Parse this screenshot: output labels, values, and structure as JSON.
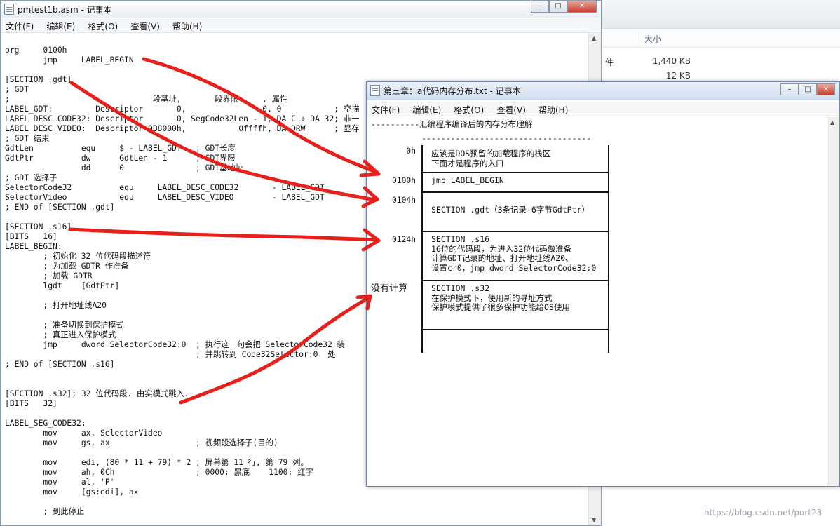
{
  "explorer": {
    "col_size": "大小",
    "rows": [
      {
        "frag": "件",
        "size": "1,440 KB"
      },
      {
        "frag": "",
        "size": "12 KB"
      }
    ]
  },
  "np1": {
    "title": "pmtest1b.asm - 记事本",
    "menu": [
      "文件(F)",
      "编辑(E)",
      "格式(O)",
      "查看(V)",
      "帮助(H)"
    ],
    "lines": [
      "org     0100h",
      "        jmp     LABEL_BEGIN",
      "",
      "[SECTION .gdt]",
      "; GDT",
      ";                              段基址,       段界限     , 属性",
      "LABEL_GDT:         Descriptor       0,                0, 0           ; 空描",
      "LABEL_DESC_CODE32: Descriptor       0, SegCode32Len - 1, DA_C + DA_32; 非一",
      "LABEL_DESC_VIDEO:  Descriptor 0B8000h,           0ffffh, DA_DRW      ; 显存",
      "; GDT 结束",
      "GdtLen          equ     $ - LABEL_GDT   ; GDT长度",
      "GdtPtr          dw      GdtLen - 1      ; GDT界限",
      "                dd      0               ; GDT基地址",
      "; GDT 选择子",
      "SelectorCode32          equ     LABEL_DESC_CODE32       - LABEL_GDT",
      "SelectorVideo           equ     LABEL_DESC_VIDEO        - LABEL_GDT",
      "; END of [SECTION .gdt]",
      "",
      "[SECTION .s16]",
      "[BITS   16]",
      "LABEL_BEGIN:",
      "        ; 初始化 32 位代码段描述符",
      "        ; 为加载 GDTR 作准备",
      "        ; 加载 GDTR",
      "        lgdt    [GdtPtr]",
      "",
      "        ; 打开地址线A20",
      "",
      "        ; 准备切换到保护模式",
      "        ; 真正进入保护模式",
      "        jmp     dword SelectorCode32:0  ; 执行这一句会把 SelectorCode32 装",
      "                                        ; 并跳转到 Code32Selector:0  处",
      "; END of [SECTION .s16]",
      "",
      "",
      "[SECTION .s32]; 32 位代码段. 由实模式跳入.",
      "[BITS   32]",
      "",
      "LABEL_SEG_CODE32:",
      "        mov     ax, SelectorVideo",
      "        mov     gs, ax                  ; 视频段选择子(目的)",
      "",
      "        mov     edi, (80 * 11 + 79) * 2 ; 屏幕第 11 行, 第 79 列。",
      "        mov     ah, 0Ch                 ; 0000: 黑底    1100: 红字",
      "        mov     al, 'P'",
      "        mov     [gs:edi], ax",
      "",
      "        ; 到此停止"
    ]
  },
  "np2": {
    "title": "第三章：a代码内存分布.txt - 记事本",
    "menu": [
      "文件(F)",
      "编辑(E)",
      "格式(O)",
      "查看(V)",
      "帮助(H)"
    ],
    "heading": "----------汇编程序编译后的内存分布理解",
    "dashes": "-----------------------------------",
    "rows": [
      {
        "label": "0h",
        "text": "应该是DOS预留的加载程序的栈区\n下面才是程序的入口"
      },
      {
        "label": "0100h",
        "text": "jmp LABEL_BEGIN"
      },
      {
        "label": "0104h",
        "text": "SECTION .gdt（3条记录+6字节GdtPtr）"
      },
      {
        "label": "0124h",
        "text": "SECTION .s16\n16位的代码段，为进入32位代码做准备\n计算GDT记录的地址、打开地址线A20、\n设置cr0，jmp dword SelectorCode32:0"
      },
      {
        "label": "没有计算",
        "text": "SECTION .s32\n在保护模式下，使用新的寻址方式\n保护模式提供了很多保护功能给OS使用"
      },
      {
        "label": "",
        "text": ""
      }
    ]
  },
  "annotations": {
    "color": "#e8201c",
    "arrow_count": 5
  },
  "watermark": "https://blog.csdn.net/port23"
}
